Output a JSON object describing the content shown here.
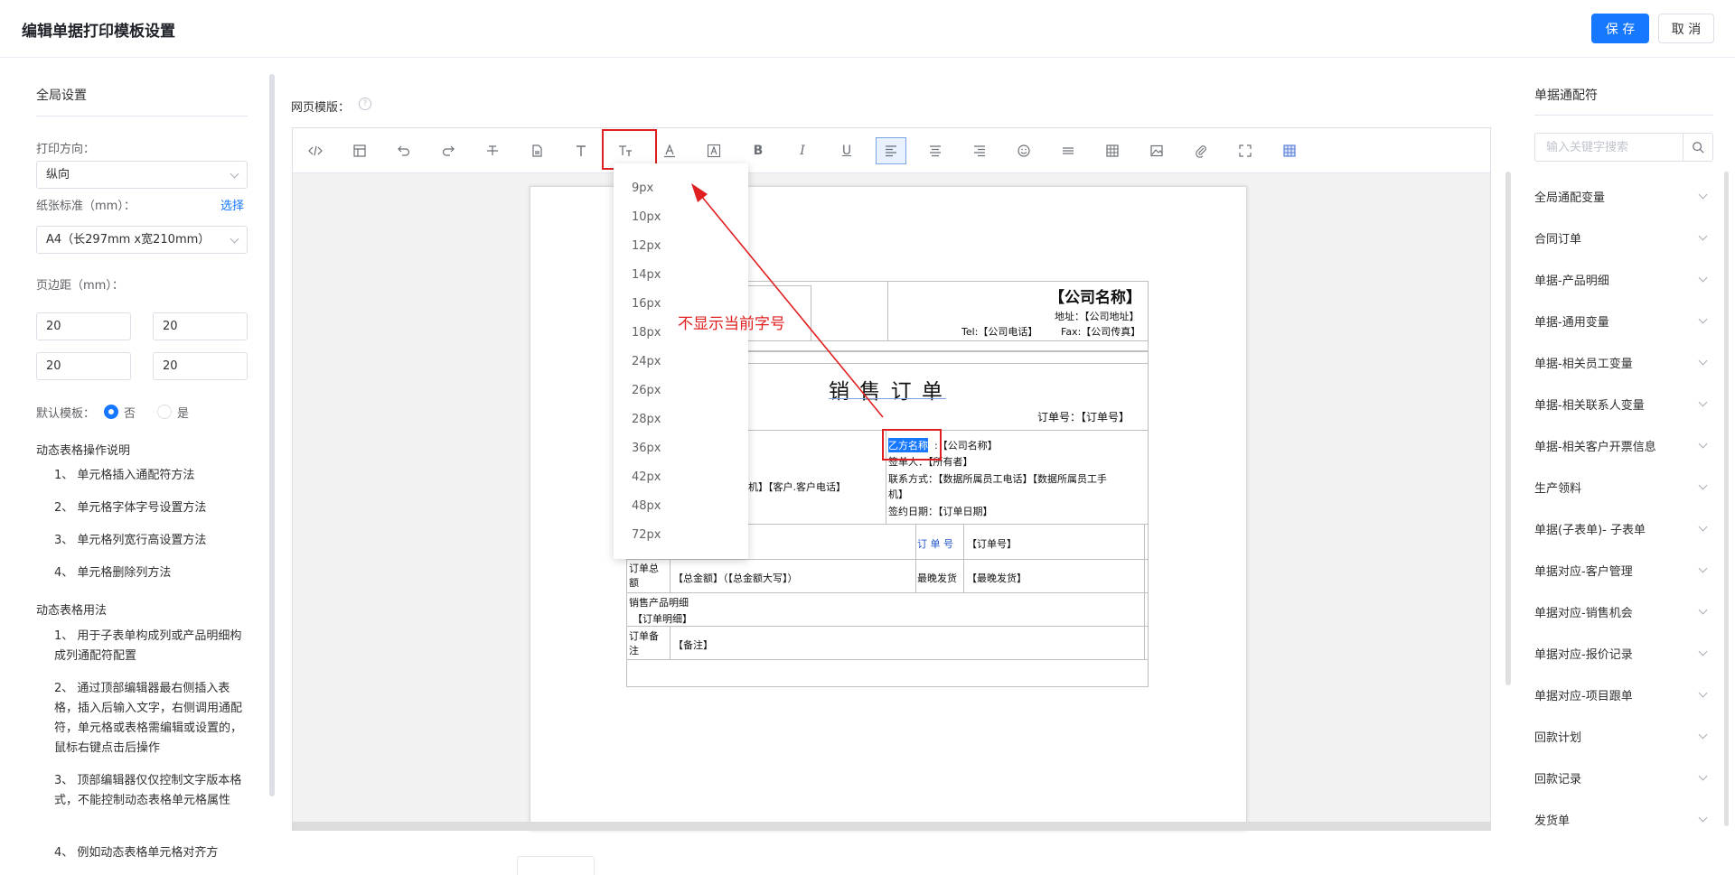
{
  "header": {
    "title": "编辑单据打印模板设置",
    "save_label": "保 存",
    "cancel_label": "取 消"
  },
  "left": {
    "global_title": "全局设置",
    "direction_label": "打印方向：",
    "direction_value": "纵向",
    "paper_label": "纸张标准（mm）：",
    "paper_link": "选择",
    "paper_value": "A4（长297mm x宽210mm）",
    "margin_label": "页边距（mm）：",
    "margins": [
      "20",
      "20",
      "20",
      "20"
    ],
    "default_label": "默认模板：",
    "default_options": [
      "否",
      "是"
    ],
    "default_selected": "否",
    "dyn_ops_title": "动态表格操作说明",
    "dyn_ops": [
      "1、 单元格插入通配符方法",
      "2、 单元格字体字号设置方法",
      "3、 单元格列宽行高设置方法",
      "4、 单元格删除列方法"
    ],
    "dyn_usage_title": "动态表格用法",
    "dyn_usage": [
      "1、 用于子表单构成列或产品明细构成列通配符配置",
      "2、 通过顶部编辑器最右侧插入表格，插入后输入文字，右侧调用通配符，单元格或表格需编辑或设置的，鼠标右键点击后操作",
      "3、 顶部编辑器仅仅控制文字版本格式，不能控制动态表格单元格属性",
      "4、 例如动态表格单元格对齐方"
    ]
  },
  "editor": {
    "label": "网页模版：",
    "toolbar": [
      "source-code",
      "template",
      "undo",
      "redo",
      "strikethrough",
      "document",
      "font-family",
      "font-size",
      "font-color",
      "background-color",
      "bold",
      "italic",
      "underline",
      "align-left",
      "align-center",
      "align-right",
      "emoji",
      "horizontal-rule",
      "table",
      "image",
      "attachment",
      "fullscreen",
      "insert-table"
    ]
  },
  "font_sizes": [
    "9px",
    "10px",
    "12px",
    "14px",
    "16px",
    "18px",
    "24px",
    "26px",
    "28px",
    "36px",
    "42px",
    "48px",
    "72px"
  ],
  "annotation": "不显示当前字号",
  "doc": {
    "company_name": "【公司名称】",
    "address": "地址：【公司地址】",
    "tel": "Tel:【公司电话】",
    "fax": "Fax:【公司传真】",
    "title": "销 售 订 单",
    "order_no_line": "订单号：【订单号】",
    "party_b_name": "乙方名称",
    "party_b_value": ":【公司名称】",
    "signer": "签单人：【所有者】",
    "contact": "联系方式：【数据所属员工电话】【数据所属员工手",
    "contact2": "机】",
    "sign_date": "签约日期：【订单日期】",
    "left_phone": "机】【客户.客户电话】",
    "order_no_label": "订 单 号",
    "order_no_value": "【订单号】",
    "total_label": "订单总额",
    "total_value": "【总金额】（【总金额大写】）",
    "latest_label": "最晚发货",
    "latest_value": "【最晚发货】",
    "detail_label": "销售产品明细",
    "detail_value": "【订单明细】",
    "remark_label": "订单备注",
    "remark_value": "【备注】"
  },
  "right": {
    "title": "单据通配符",
    "search_placeholder": "输入关键字搜索",
    "items": [
      "全局通配变量",
      "合同订单",
      "单据-产品明细",
      "单据-通用变量",
      "单据-相关员工变量",
      "单据-相关联系人变量",
      "单据-相关客户开票信息",
      "生产领料",
      "单据(子表单)- 子表单",
      "单据对应-客户管理",
      "单据对应-销售机会",
      "单据对应-报价记录",
      "单据对应-项目跟单",
      "回款计划",
      "回款记录",
      "发货单"
    ]
  },
  "colors": {
    "accent": "#1677ff",
    "annotation": "#e02020"
  }
}
